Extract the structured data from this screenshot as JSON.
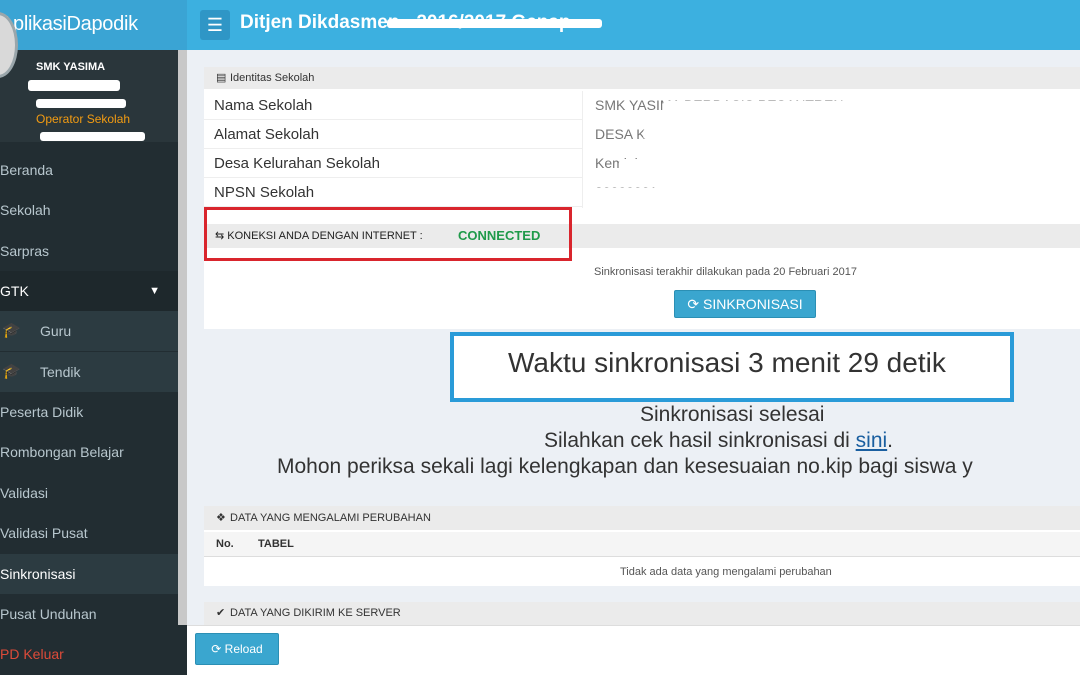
{
  "app": {
    "logo": "AplikasiDapodik",
    "title": "Ditjen Dikdasmen - 2016/2017 Genap"
  },
  "user": {
    "name_line1": "SMK YASIMA",
    "role": "Operator Sekolah"
  },
  "sidebar": {
    "items": [
      {
        "label": "Beranda"
      },
      {
        "label": "Sekolah"
      },
      {
        "label": "Sarpras"
      },
      {
        "label": "GTK"
      },
      {
        "label": "Guru"
      },
      {
        "label": "Tendik"
      },
      {
        "label": "Peserta Didik"
      },
      {
        "label": "Rombongan Belajar"
      },
      {
        "label": "Validasi"
      },
      {
        "label": "Validasi Pusat"
      },
      {
        "label": "Sinkronisasi"
      },
      {
        "label": "Pusat Unduhan"
      },
      {
        "label": "PD Keluar"
      }
    ]
  },
  "identitas": {
    "header": "Identitas Sekolah",
    "rows": [
      {
        "label": "Nama Sekolah",
        "value": "SMK YASIMA BERBASIS PESANTREN"
      },
      {
        "label": "Alamat Sekolah",
        "value": "DESA KEMLOKO RT 10 RW 03 KEC. GODONG KAB."
      },
      {
        "label": "Desa Kelurahan Sekolah",
        "value": "Kemloko"
      },
      {
        "label": "NPSN Sekolah",
        "value": "30000001"
      }
    ]
  },
  "koneksi": {
    "label": "KONEKSI ANDA DENGAN INTERNET :",
    "status": "CONNECTED"
  },
  "sync": {
    "last": "Sinkronisasi terakhir dilakukan pada 20 Februari 2017",
    "button": "SINKRONISASI",
    "time": "Waktu sinkronisasi 3 menit 29 detik",
    "done": "Sinkronisasi selesai",
    "check_prefix": "Silahkan cek hasil sinkronisasi di ",
    "check_link": "sini",
    "check_suffix": ".",
    "notice": "Mohon periksa sekali lagi kelengkapan dan kesesuaian no.kip bagi siswa y"
  },
  "perubahan": {
    "header": "DATA YANG MENGALAMI PERUBAHAN",
    "col_no": "No.",
    "col_tabel": "TABEL",
    "empty": "Tidak ada data yang mengalami perubahan"
  },
  "dikirim": {
    "header": "DATA YANG DIKIRIM KE SERVER"
  },
  "footer": {
    "reload": "Reload"
  }
}
